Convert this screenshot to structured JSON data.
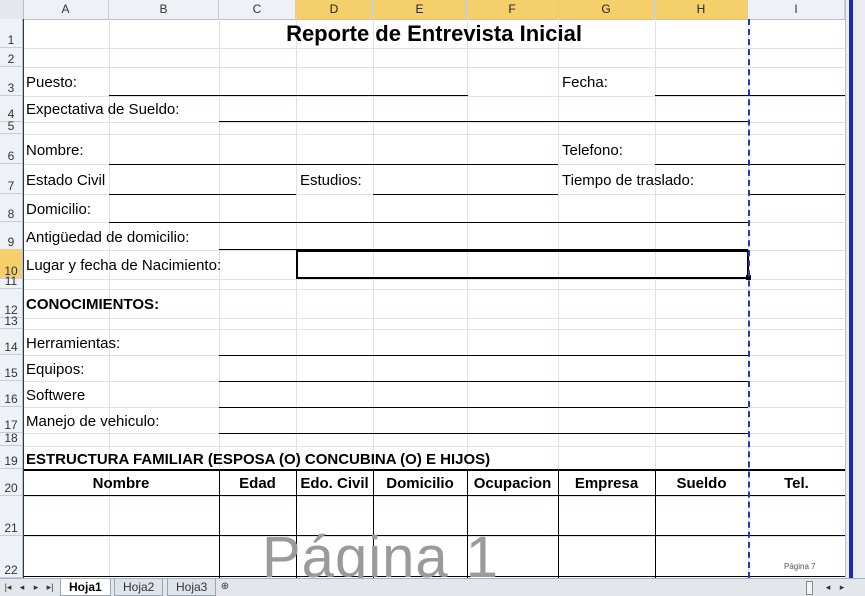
{
  "sheet": {
    "columns": [
      "A",
      "B",
      "C",
      "D",
      "E",
      "F",
      "G",
      "H",
      "I"
    ],
    "selected_columns": [
      "D",
      "E",
      "F",
      "G",
      "H"
    ],
    "rows": [
      "1",
      "2",
      "3",
      "4",
      "5",
      "6",
      "7",
      "8",
      "9",
      "10",
      "11",
      "12",
      "13",
      "14",
      "15",
      "16",
      "17",
      "18",
      "19",
      "20",
      "21",
      "22"
    ],
    "selected_row": "10"
  },
  "form": {
    "title": "Reporte de Entrevista Inicial",
    "puesto": "Puesto:",
    "fecha": "Fecha:",
    "expectativa": "Expectativa de Sueldo:",
    "nombre": "Nombre:",
    "telefono": "Telefono:",
    "estado_civil": "Estado Civil",
    "estudios": "Estudios:",
    "tiempo": "Tiempo de traslado:",
    "domicilio": "Domicilio:",
    "antiguedad": "Antigüedad de domicilio:",
    "lugar": "Lugar  y fecha de Nacimiento:",
    "conocimientos": "CONOCIMIENTOS:",
    "herramientas": "Herramientas:",
    "equipos": "Equipos:",
    "softwere": "Softwere",
    "manejo": "Manejo de vehiculo:",
    "estructura": "ESTRUCTURA FAMILIAR (ESPOSA (O) CONCUBINA (O) E HIJOS)"
  },
  "table_headers": [
    "Nombre",
    "Edad",
    "Edo. Civil",
    "Domicilio",
    "Ocupacion",
    "Empresa",
    "Sueldo",
    "Tel."
  ],
  "watermark": "Página 1",
  "small_page_label": "Página 7",
  "tabs": [
    "Hoja1",
    "Hoja2",
    "Hoja3"
  ],
  "active_tab": "Hoja1",
  "colors": {
    "page_break": "#2433c8",
    "selection": "#f4cf6a"
  }
}
